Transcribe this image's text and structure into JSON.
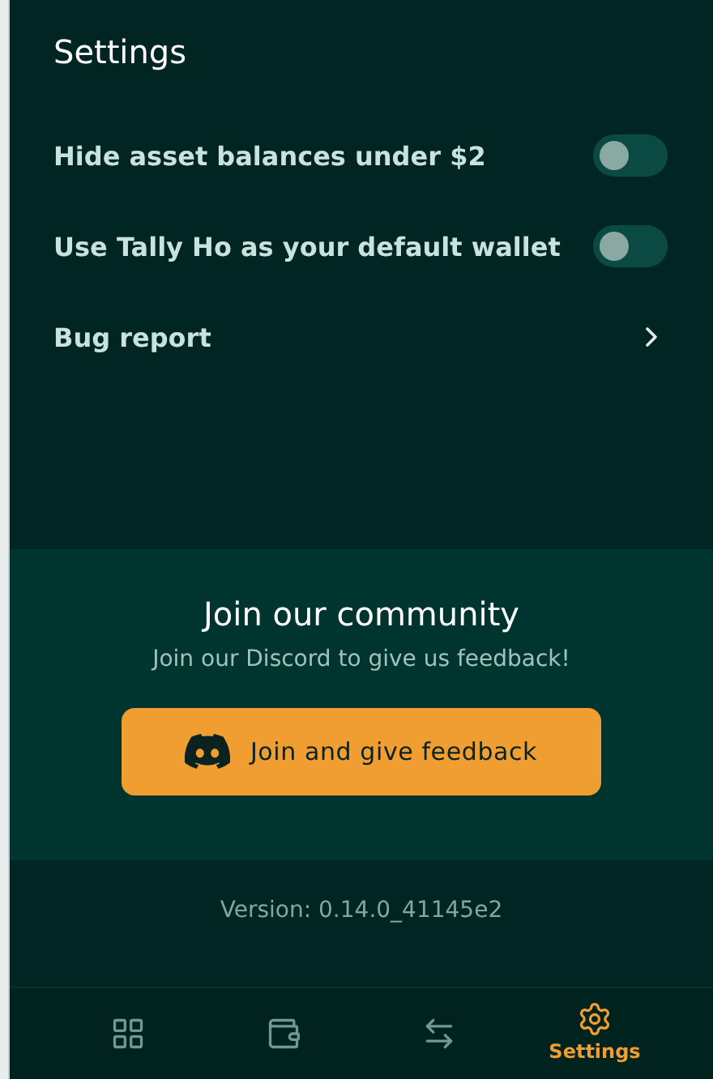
{
  "title": "Settings",
  "settings": [
    {
      "kind": "toggle",
      "label": "Hide asset balances under $2",
      "on": false
    },
    {
      "kind": "toggle",
      "label": "Use Tally Ho as your default wallet",
      "on": false
    },
    {
      "kind": "link",
      "label": "Bug report"
    }
  ],
  "community": {
    "title": "Join our community",
    "subtitle": "Join our Discord to give us feedback!",
    "button": "Join and give feedback"
  },
  "version": "Version: 0.14.0_41145e2",
  "nav": [
    {
      "kind": "grid",
      "selected": false
    },
    {
      "kind": "wallet",
      "selected": false
    },
    {
      "kind": "swap",
      "selected": false
    },
    {
      "kind": "settings",
      "selected": true,
      "label": "Settings"
    }
  ]
}
